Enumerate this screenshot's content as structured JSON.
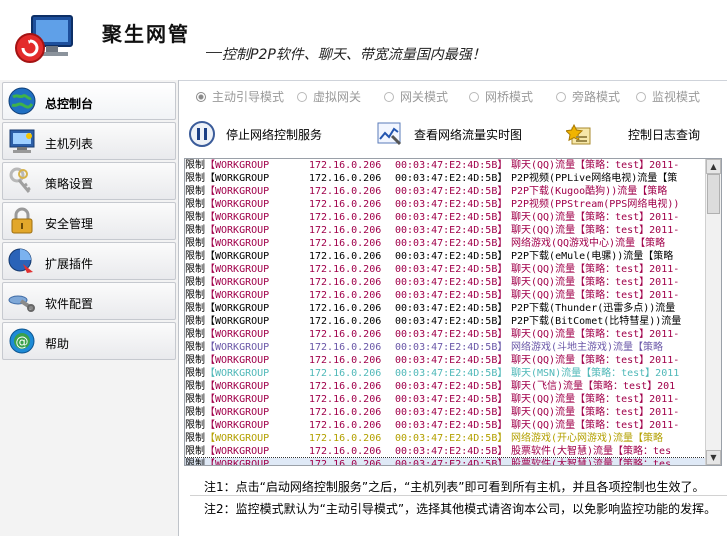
{
  "app": {
    "title": "聚生网管",
    "slogan": "控制P2P软件、聊天、带宽流量国内最强！"
  },
  "sidebar": {
    "items": [
      {
        "label": "总控制台",
        "icon": "globe-icon",
        "active": true
      },
      {
        "label": "主机列表",
        "icon": "computer-icon",
        "active": false
      },
      {
        "label": "策略设置",
        "icon": "keys-icon",
        "active": false
      },
      {
        "label": "安全管理",
        "icon": "lock-icon",
        "active": false
      },
      {
        "label": "扩展插件",
        "icon": "plugin-icon",
        "active": false
      },
      {
        "label": "软件配置",
        "icon": "wrench-icon",
        "active": false
      },
      {
        "label": "帮助",
        "icon": "help-icon",
        "active": false
      }
    ]
  },
  "modes": [
    {
      "label": "主动引导模式",
      "checked": true
    },
    {
      "label": "虚拟网关",
      "checked": false
    },
    {
      "label": "网关模式",
      "checked": false
    },
    {
      "label": "网桥模式",
      "checked": false
    },
    {
      "label": "旁路模式",
      "checked": false
    },
    {
      "label": "监视模式",
      "checked": false
    }
  ],
  "toolbar": {
    "stop_label": "停止网络控制服务",
    "chart_label": "查看网络流量实时图",
    "log_label": "控制日志查询"
  },
  "log": {
    "rows": [
      {
        "flag": "限制",
        "group": "【WORKGROUP",
        "ip": "172.16.0.206",
        "mac": "00:03:47:E2:4D:5B】",
        "event": "聊天(QQ)流量【策略：test】2011-",
        "color": "#a0004a",
        "selected": false
      },
      {
        "flag": "限制",
        "group": "【WORKGROUP",
        "ip": "172.16.0.206",
        "mac": "00:03:47:E2:4D:5B】",
        "event": "P2P视频(PPLive网络电视)流量【策",
        "color": "#000000",
        "selected": false
      },
      {
        "flag": "限制",
        "group": "【WORKGROUP",
        "ip": "172.16.0.206",
        "mac": "00:03:47:E2:4D:5B】",
        "event": "P2P下载(Kugoo酷狗))流量【策略",
        "color": "#a0004a",
        "selected": false
      },
      {
        "flag": "限制",
        "group": "【WORKGROUP",
        "ip": "172.16.0.206",
        "mac": "00:03:47:E2:4D:5B】",
        "event": "P2P视频(PPStream(PPS网络电视))",
        "color": "#a0004a",
        "selected": false
      },
      {
        "flag": "限制",
        "group": "【WORKGROUP",
        "ip": "172.16.0.206",
        "mac": "00:03:47:E2:4D:5B】",
        "event": "聊天(QQ)流量【策略：test】2011-",
        "color": "#a0004a",
        "selected": false
      },
      {
        "flag": "限制",
        "group": "【WORKGROUP",
        "ip": "172.16.0.206",
        "mac": "00:03:47:E2:4D:5B】",
        "event": "聊天(QQ)流量【策略：test】2011-",
        "color": "#a0004a",
        "selected": false
      },
      {
        "flag": "限制",
        "group": "【WORKGROUP",
        "ip": "172.16.0.206",
        "mac": "00:03:47:E2:4D:5B】",
        "event": "网络游戏(QQ游戏中心)流量【策略",
        "color": "#a0004a",
        "selected": false
      },
      {
        "flag": "限制",
        "group": "【WORKGROUP",
        "ip": "172.16.0.206",
        "mac": "00:03:47:E2:4D:5B】",
        "event": "P2P下载(eMule(电骡))流量【策略",
        "color": "#000000",
        "selected": false
      },
      {
        "flag": "限制",
        "group": "【WORKGROUP",
        "ip": "172.16.0.206",
        "mac": "00:03:47:E2:4D:5B】",
        "event": "聊天(QQ)流量【策略：test】2011-",
        "color": "#a0004a",
        "selected": false
      },
      {
        "flag": "限制",
        "group": "【WORKGROUP",
        "ip": "172.16.0.206",
        "mac": "00:03:47:E2:4D:5B】",
        "event": "聊天(QQ)流量【策略：test】2011-",
        "color": "#a0004a",
        "selected": false
      },
      {
        "flag": "限制",
        "group": "【WORKGROUP",
        "ip": "172.16.0.206",
        "mac": "00:03:47:E2:4D:5B】",
        "event": "聊天(QQ)流量【策略：test】2011-",
        "color": "#a0004a",
        "selected": false
      },
      {
        "flag": "限制",
        "group": "【WORKGROUP",
        "ip": "172.16.0.206",
        "mac": "00:03:47:E2:4D:5B】",
        "event": "P2P下载(Thunder(迅雷多点))流量",
        "color": "#000000",
        "selected": false
      },
      {
        "flag": "限制",
        "group": "【WORKGROUP",
        "ip": "172.16.0.206",
        "mac": "00:03:47:E2:4D:5B】",
        "event": "P2P下载(BitComet(比特彗星))流量",
        "color": "#000000",
        "selected": false
      },
      {
        "flag": "限制",
        "group": "【WORKGROUP",
        "ip": "172.16.0.206",
        "mac": "00:03:47:E2:4D:5B】",
        "event": "聊天(QQ)流量【策略：test】2011-",
        "color": "#a0004a",
        "selected": false
      },
      {
        "flag": "限制",
        "group": "【WORKGROUP",
        "ip": "172.16.0.206",
        "mac": "00:03:47:E2:4D:5B】",
        "event": "网络游戏(斗地主游戏)流量【策略",
        "color": "#6b58a8",
        "selected": false
      },
      {
        "flag": "限制",
        "group": "【WORKGROUP",
        "ip": "172.16.0.206",
        "mac": "00:03:47:E2:4D:5B】",
        "event": "聊天(QQ)流量【策略：test】2011-",
        "color": "#a0004a",
        "selected": false
      },
      {
        "flag": "限制",
        "group": "【WORKGROUP",
        "ip": "172.16.0.206",
        "mac": "00:03:47:E2:4D:5B】",
        "event": "聊天(MSN)流量【策略：test】2011",
        "color": "#4fb8b8",
        "selected": false
      },
      {
        "flag": "限制",
        "group": "【WORKGROUP",
        "ip": "172.16.0.206",
        "mac": "00:03:47:E2:4D:5B】",
        "event": "聊天(飞信)流量【策略：test】201",
        "color": "#a0004a",
        "selected": false
      },
      {
        "flag": "限制",
        "group": "【WORKGROUP",
        "ip": "172.16.0.206",
        "mac": "00:03:47:E2:4D:5B】",
        "event": "聊天(QQ)流量【策略：test】2011-",
        "color": "#a0004a",
        "selected": false
      },
      {
        "flag": "限制",
        "group": "【WORKGROUP",
        "ip": "172.16.0.206",
        "mac": "00:03:47:E2:4D:5B】",
        "event": "聊天(QQ)流量【策略：test】2011-",
        "color": "#a0004a",
        "selected": false
      },
      {
        "flag": "限制",
        "group": "【WORKGROUP",
        "ip": "172.16.0.206",
        "mac": "00:03:47:E2:4D:5B】",
        "event": "聊天(QQ)流量【策略：test】2011-",
        "color": "#a0004a",
        "selected": false
      },
      {
        "flag": "限制",
        "group": "【WORKGROUP",
        "ip": "172.16.0.206",
        "mac": "00:03:47:E2:4D:5B】",
        "event": "网络游戏(开心网游戏)流量【策略",
        "color": "#b3a000",
        "selected": false
      },
      {
        "flag": "限制",
        "group": "【WORKGROUP",
        "ip": "172.16.0.206",
        "mac": "00:03:47:E2:4D:5B】",
        "event": "股票软件(大智慧)流量【策略：tes",
        "color": "#a0004a",
        "selected": false
      },
      {
        "flag": "限制",
        "group": "【WORKGROUP",
        "ip": "172.16.0.206",
        "mac": "00:03:47:E2:4D:5B】",
        "event": "股票软件(大智慧)流量【策略：tes",
        "color": "#a0004a",
        "selected": true
      }
    ]
  },
  "notes": {
    "note1": "注1：点击“启动网络控制服务”之后，“主机列表”即可看到所有主机，并且各项控制也生效了。",
    "note2": "注2：监控模式默认为“主动引导模式”，选择其他模式请咨询本公司，以免影响监控功能的发挥。"
  }
}
